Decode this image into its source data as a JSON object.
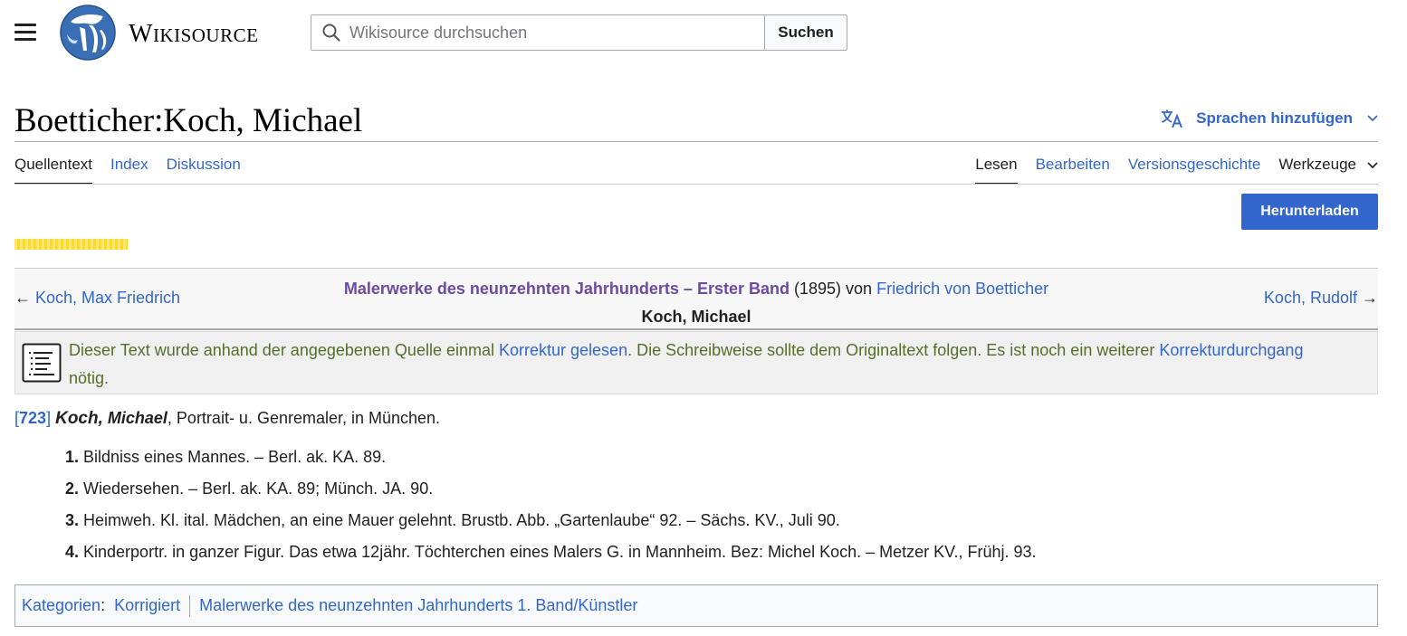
{
  "header": {
    "site_name_big": "W",
    "site_name_small": "IKISOURCE",
    "search_placeholder": "Wikisource durchsuchen",
    "search_button": "Suchen"
  },
  "page": {
    "title": "Boetticher:Koch, Michael",
    "lang_button": "Sprachen hinzufügen"
  },
  "tabs_left": [
    "Quellentext",
    "Index",
    "Diskussion"
  ],
  "tabs_right": [
    "Lesen",
    "Bearbeiten",
    "Versionsgeschichte",
    "Werkzeuge"
  ],
  "download_button": "Herunterladen",
  "nav": {
    "prev_arrow": "←",
    "prev": "Koch, Max Friedrich",
    "next": "Koch, Rudolf",
    "next_arrow": "→",
    "work_title": "Malerwerke des neunzehnten Jahrhunderts – Erster Band",
    "year": "(1895) von",
    "author": "Friedrich von Boetticher",
    "lemma": "Koch, Michael"
  },
  "notice": {
    "part1": "Dieser Text wurde anhand der angegebenen Quelle einmal ",
    "link1": "Korrektur gelesen",
    "part2": ". Die Schreibweise sollte dem Originaltext folgen. Es ist noch ein weiterer ",
    "link2": "Korrekturdurchgang",
    "part3": "nötig."
  },
  "entry": {
    "bracket_open": "[",
    "page_number": "723",
    "bracket_close": "]",
    "surname": "Koch,",
    "forename": "Michael",
    "description": ", Portrait- u. Genremaler, in München."
  },
  "works": [
    {
      "num": "1.",
      "text": "Bildniss eines Mannes. – Berl. ak. KA. 89."
    },
    {
      "num": "2.",
      "text": "Wiedersehen. – Berl. ak. KA. 89; Münch. JA. 90."
    },
    {
      "num": "3.",
      "text": "Heimweh. Kl. ital. Mädchen, an eine Mauer gelehnt. Brustb. Abb. „Gartenlaube“ 92. – Sächs. KV., Juli 90."
    },
    {
      "num": "4.",
      "text": "Kinderportr. in ganzer Figur. Das etwa 12jähr. Töchterchen eines Malers G. in Mannheim. Bez: Michel Koch. – Metzer KV., Frühj. 93."
    }
  ],
  "categories": {
    "label": "Kategorien",
    "colon": ":",
    "items": [
      "Korrigiert",
      "Malerwerke des neunzehnten Jahrhunderts 1. Band/Künstler"
    ]
  },
  "colors": {
    "link": "#3366cc",
    "work_title": "#6b4ba1",
    "notice_text": "#546e2a",
    "primary_button": "#3366cc"
  }
}
